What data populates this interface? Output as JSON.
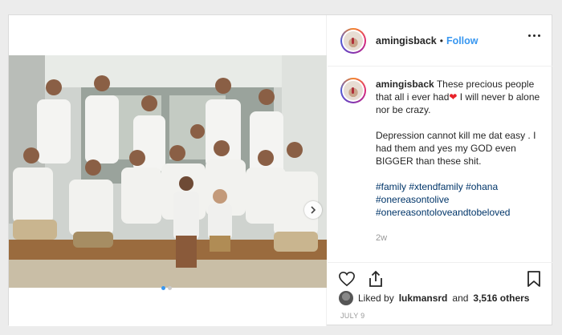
{
  "post": {
    "username": "amingisback",
    "follow_label": "Follow",
    "bullet": "•",
    "caption": {
      "username": "amingisback",
      "line1": "These precious people that all i ever had",
      "heart": "❤",
      "line1_end": " I will never b alone nor be crazy.",
      "line2": "Depression cannot kill me dat easy . I had them and yes my GOD even BIGGER than these shit.",
      "hashtags": [
        "#family",
        "#xtendfamily",
        "#ohana",
        "#onereasontolive",
        "#onereasontoloveandtobeloved"
      ],
      "time": "2w"
    },
    "likes": {
      "prefix": "Liked by",
      "user": "lukmansrd",
      "middle": "and",
      "others": "3,516 others"
    },
    "date": "JULY 9"
  },
  "icons": {
    "more": "more-options-icon",
    "heart": "heart-icon",
    "share": "share-icon",
    "bookmark": "bookmark-icon",
    "carousel_next": "chevron-right-icon",
    "tag": "user-tag-icon"
  },
  "colors": {
    "link": "#3897f0",
    "hashtag": "#003569",
    "heart": "#e8232a"
  }
}
